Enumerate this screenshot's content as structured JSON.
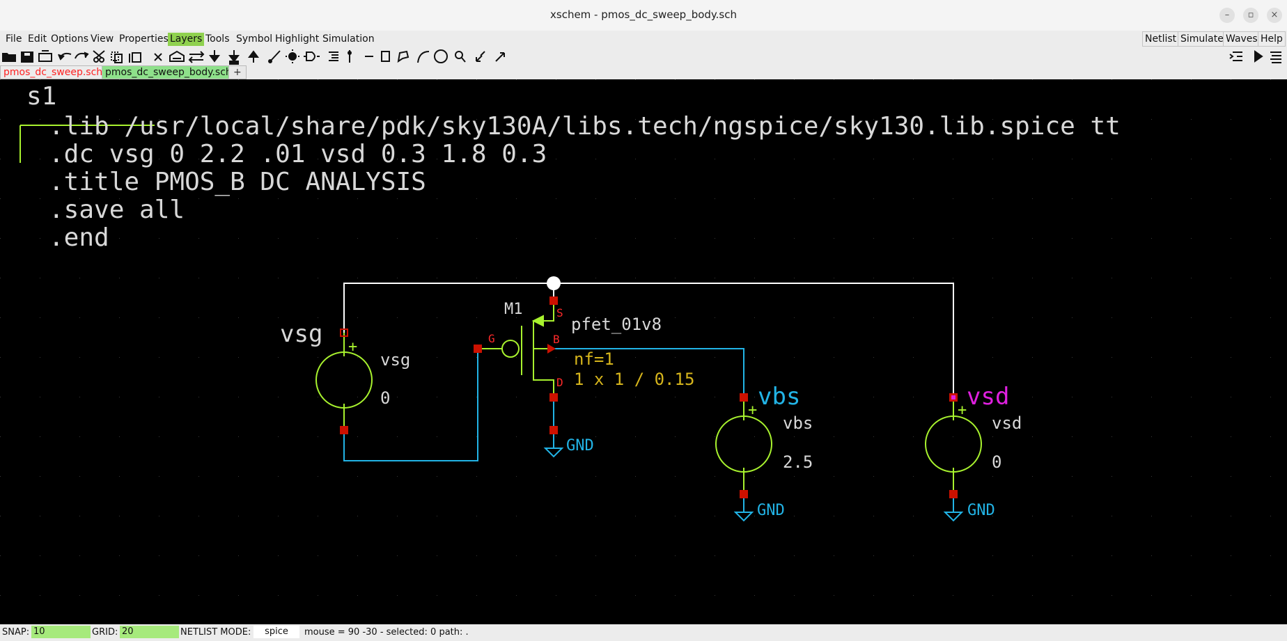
{
  "window": {
    "title": "xschem - pmos_dc_sweep_body.sch"
  },
  "menu": {
    "items": [
      "File",
      "Edit",
      "Options",
      "View",
      "Properties",
      "Layers",
      "Tools",
      "Symbol",
      "Highlight",
      "Simulation"
    ],
    "active": "Layers",
    "right_buttons": [
      "Netlist",
      "Simulate",
      "Waves",
      "Help"
    ]
  },
  "tabs": [
    {
      "label": "pmos_dc_sweep.sch",
      "active": false
    },
    {
      "label": "pmos_dc_sweep_body.sch",
      "active": true
    },
    {
      "label": "+",
      "active": false
    }
  ],
  "schematic": {
    "code_block": {
      "name": "s1",
      "lines": [
        ".lib /usr/local/share/pdk/sky130A/libs.tech/ngspice/sky130.lib.spice tt",
        ".dc vsg 0 2.2 .01 vsd 0.3 1.8 0.3",
        ".title PMOS_B DC ANALYSIS",
        ".save all",
        ".end"
      ]
    },
    "transistor": {
      "name": "M1",
      "model": "pfet_01v8",
      "nf": "nf=1",
      "size": "1 x 1 / 0.15",
      "pins": {
        "source": "S",
        "gate": "G",
        "bulk": "B",
        "drain": "D"
      }
    },
    "sources": [
      {
        "label": "vsg",
        "name": "vsg",
        "value": "0"
      },
      {
        "label": "vbs",
        "name": "vbs",
        "value": "2.5"
      },
      {
        "label": "vsd",
        "name": "vsd",
        "value": "0"
      }
    ],
    "ground_label": "GND",
    "plus_sign": "+"
  },
  "status": {
    "snap_label": "SNAP:",
    "snap_value": "10",
    "grid_label": "GRID:",
    "grid_value": "20",
    "netlist_label": "NETLIST MODE:",
    "netlist_value": "spice",
    "mouse_info": "mouse = 90 -30 - selected: 0 path: ."
  },
  "colors": {
    "menu_active": "#8fd14f",
    "tab_active": "#8ee08a",
    "tab_inactive_text": "#ff2222",
    "wire": "#ffffff",
    "net": "#22b4e6",
    "symbol": "#a8f22e",
    "pin": "#cc1100",
    "attr": "#d6b51c",
    "label_vsd": "#e020e0",
    "text": "#d8d8d8"
  },
  "icons": [
    "open-icon",
    "save-icon",
    "reload-icon",
    "undo-icon",
    "redo-icon",
    "cut-icon",
    "copy-icon",
    "duplicate-icon",
    "delete-icon",
    "move-icon",
    "swap-icon",
    "push-icon",
    "edit-icon",
    "pop-icon",
    "brush-icon",
    "highlight-icon",
    "gate-icon",
    "netlist-icon",
    "probe-icon",
    "line-icon",
    "rect-icon",
    "polygon-icon",
    "arc-icon",
    "circle-icon",
    "zoom-icon",
    "zoom-in-icon",
    "zoom-out-icon",
    "insert-icon",
    "simulate-icon",
    "waves-icon"
  ]
}
